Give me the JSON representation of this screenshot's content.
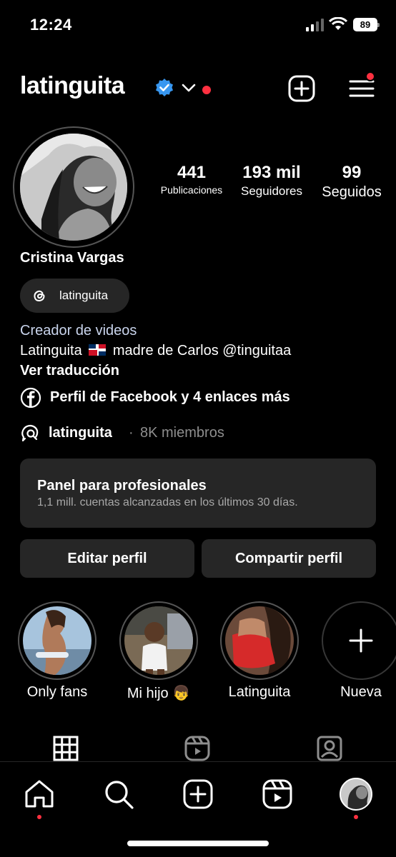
{
  "status_bar": {
    "time": "12:24",
    "battery": "89",
    "icons": [
      "signal-icon",
      "wifi-icon",
      "battery-icon"
    ]
  },
  "header": {
    "username": "latinguita",
    "icons": [
      "verified-badge-icon",
      "chevron-down-icon",
      "add-icon",
      "menu-icon"
    ],
    "accent_color": "#ff3040",
    "verified_color": "#3897f0"
  },
  "profile": {
    "stats": [
      {
        "value": "441",
        "label": "Publicaciones"
      },
      {
        "value": "193 mil",
        "label": "Seguidores"
      },
      {
        "value": "99",
        "label": "Seguidos"
      }
    ],
    "display_name": "Cristina Vargas",
    "threads_label": "latinguita",
    "category": "Creador de videos",
    "bio_part1": "Latinguita",
    "bio_part2": "madre de Carlos @tinguitaa",
    "see_translation": "Ver traducción",
    "links_text": "Perfil de Facebook y 4 enlaces más",
    "channel": {
      "name": "latinguita",
      "separator": "·",
      "members": "8K miembros"
    }
  },
  "pro_panel": {
    "title": "Panel para profesionales",
    "subtitle": "1,1 mill. cuentas alcanzadas en los últimos 30 días."
  },
  "buttons": {
    "edit": "Editar perfil",
    "share": "Compartir perfil"
  },
  "highlights": [
    {
      "label": "Only fans"
    },
    {
      "label": "Mi hijo 👦"
    },
    {
      "label": "Latinguita"
    },
    {
      "label": "Nueva"
    }
  ],
  "tabs": [
    "grid-icon",
    "reels-icon",
    "tagged-icon"
  ],
  "bottom_nav": [
    "home-icon",
    "search-icon",
    "create-icon",
    "reels-icon",
    "profile-icon"
  ]
}
